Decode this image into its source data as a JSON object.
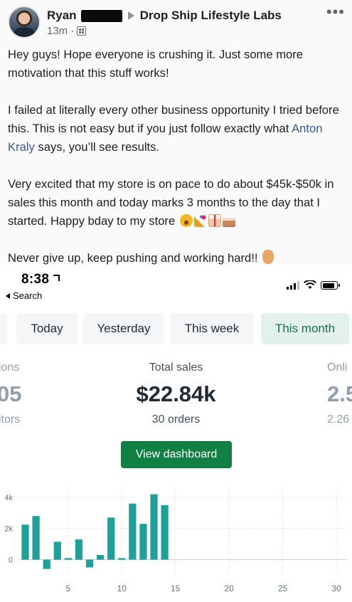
{
  "post": {
    "author_first_name": "Ryan",
    "group_name": "Drop Ship Lifestyle Labs",
    "timestamp": "13m",
    "meta_separator": "·",
    "more_icon": "more-dots-icon",
    "paragraphs": {
      "p1": "Hey guys!  Hope everyone is crushing it.  Just some more motivation that this stuff works!",
      "p2_before": "I failed at literally every other business opportunity I tried before this.  This is not easy but if you just follow exactly what ",
      "p2_link": "Anton Kraly",
      "p2_after": " says, you’ll see results.",
      "p3": "Very excited that my store is on pace to do about $45k-$50k in sales this month and today marks 3 months to the day that I started.  Happy bday to my store",
      "p4": "Never give up, keep pushing and working hard!!"
    },
    "emojis_p3": [
      "laughing-face-icon",
      "party-popper-icon",
      "gift-icon",
      "birthday-cake-icon"
    ],
    "emoji_p4": "rock-on-hand-icon",
    "link_color": "#385898"
  },
  "phone": {
    "status_time": "8:38",
    "back_label": "Search",
    "battery_level": 0.85,
    "tabs": {
      "stub": "",
      "today": "Today",
      "yesterday": "Yesterday",
      "this_week": "This week",
      "this_month": "This month",
      "active": "This month"
    },
    "metrics": {
      "left": {
        "label": "ions",
        "value": "05",
        "sub": "itors"
      },
      "center": {
        "label": "Total sales",
        "value": "$22.84k",
        "sub": "30 orders"
      },
      "right": {
        "label": "Onli",
        "value": "2.5",
        "sub": "2.26"
      }
    },
    "view_dashboard_label": "View dashboard",
    "accent_color": "#108043"
  },
  "chart_data": {
    "type": "bar",
    "x": [
      1,
      2,
      3,
      4,
      5,
      6,
      7,
      8,
      9,
      10,
      11,
      12,
      13,
      14
    ],
    "values": [
      2250,
      2800,
      -600,
      1150,
      100,
      1300,
      -500,
      300,
      2700,
      100,
      3600,
      2300,
      4200,
      3500
    ],
    "y_tick_labels": [
      "0",
      "2k",
      "4k"
    ],
    "y_ticks": [
      0,
      2000,
      4000
    ],
    "x_tick_labels": [
      "5",
      "10",
      "15",
      "20",
      "25",
      "30"
    ],
    "x_ticks": [
      5,
      10,
      15,
      20,
      25,
      30
    ],
    "xlim": [
      0.5,
      31
    ],
    "ylim": [
      -800,
      4500
    ],
    "bar_color": "#1ea19a",
    "grid": "vertical dotted"
  }
}
